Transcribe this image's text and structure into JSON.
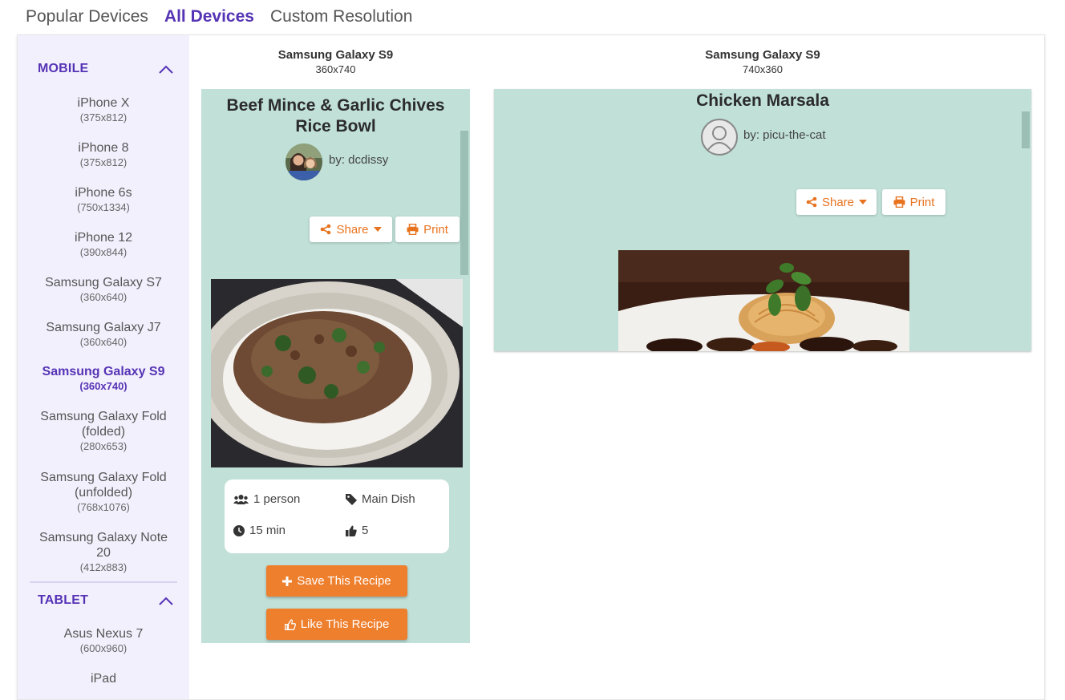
{
  "tabs": [
    {
      "label": "Popular Devices"
    },
    {
      "label": "All Devices"
    },
    {
      "label": "Custom Resolution"
    }
  ],
  "sidebar": {
    "mobile_group": {
      "label": "MOBILE"
    },
    "tablet_group": {
      "label": "TABLET"
    },
    "mobile_devices": [
      {
        "name": "iPhone X",
        "res": "(375x812)"
      },
      {
        "name": "iPhone 8",
        "res": "(375x812)"
      },
      {
        "name": "iPhone 6s",
        "res": "(750x1334)"
      },
      {
        "name": "iPhone 12",
        "res": "(390x844)"
      },
      {
        "name": "Samsung Galaxy S7",
        "res": "(360x640)"
      },
      {
        "name": "Samsung Galaxy J7",
        "res": "(360x640)"
      },
      {
        "name": "Samsung Galaxy S9",
        "res": "(360x740)",
        "selected": true
      },
      {
        "name_line1": "Samsung Galaxy Fold",
        "name_line2": "(folded)",
        "res": "(280x653)"
      },
      {
        "name_line1": "Samsung Galaxy Fold",
        "name_line2": "(unfolded)",
        "res": "(768x1076)"
      },
      {
        "name_line1": "Samsung Galaxy Note",
        "name_line2": "20",
        "res": "(412x883)"
      }
    ],
    "tablet_devices": [
      {
        "name": "Asus Nexus 7",
        "res": "(600x960)"
      },
      {
        "name": "iPad",
        "res": ""
      }
    ]
  },
  "previews": {
    "portrait": {
      "device": "Samsung Galaxy S9",
      "res": "360x740",
      "recipe_title_line1": "Beef Mince & Garlic Chives",
      "recipe_title_line2": "Rice Bowl",
      "author": "by: dcdissy",
      "share_label": "Share",
      "print_label": "Print",
      "servings": "1 person",
      "category": "Main Dish",
      "time": "15 min",
      "likes": "5",
      "save_label": "Save This Recipe",
      "like_label": "Like This Recipe"
    },
    "landscape": {
      "device": "Samsung Galaxy S9",
      "res": "740x360",
      "recipe_title": "Chicken Marsala",
      "author": "by: picu-the-cat",
      "share_label": "Share",
      "print_label": "Print"
    }
  },
  "colors": {
    "accent": "#5533b5",
    "sidebar_bg": "#f3f0fd",
    "frame_bg": "#c0e0d8",
    "orange": "#ee7f2d",
    "orange_text": "#e8731f"
  }
}
